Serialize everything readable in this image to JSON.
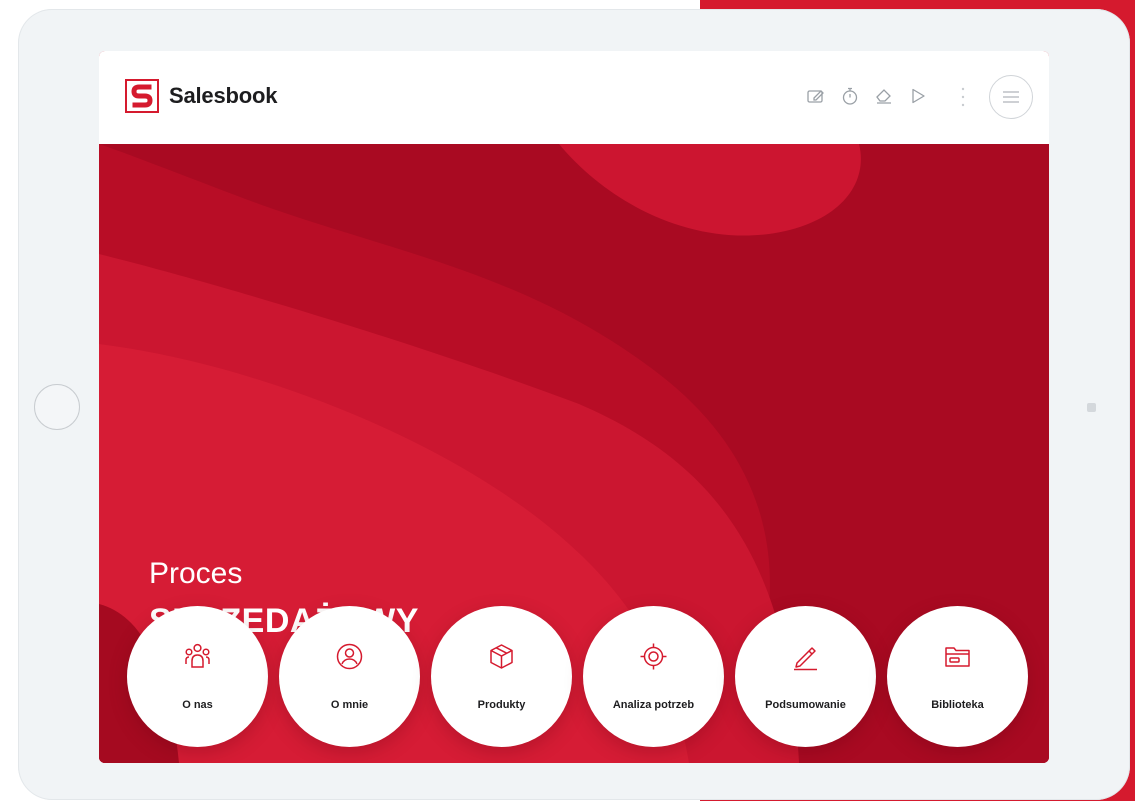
{
  "brand": {
    "name": "Salesbook",
    "accent": "#d51a2e"
  },
  "toolbar": {
    "icons": [
      "edit-icon",
      "stopwatch-icon",
      "eraser-icon",
      "play-icon",
      "more-icon",
      "menu-icon"
    ]
  },
  "hero": {
    "title_line1": "Proces",
    "title_line2": "SPRZEDAŻOWY"
  },
  "nav": {
    "items": [
      {
        "label": "O nas",
        "icon": "team-icon"
      },
      {
        "label": "O mnie",
        "icon": "user-icon"
      },
      {
        "label": "Produkty",
        "icon": "box-icon"
      },
      {
        "label": "Analiza potrzeb",
        "icon": "target-icon"
      },
      {
        "label": "Podsumowanie",
        "icon": "pencil-icon"
      },
      {
        "label": "Biblioteka",
        "icon": "folder-icon"
      }
    ]
  }
}
